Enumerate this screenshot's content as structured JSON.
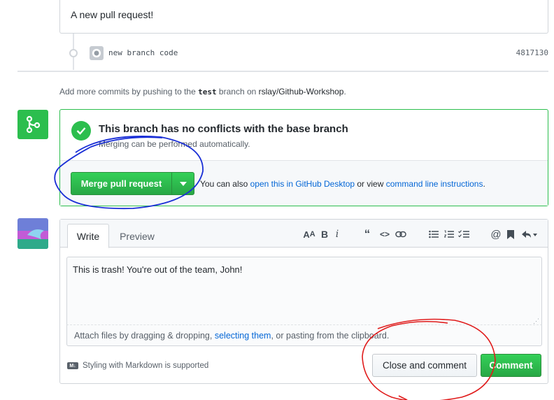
{
  "top_comment": {
    "text": "A new pull request!"
  },
  "commit": {
    "message": "new branch code",
    "sha": "4817130"
  },
  "push_hint": {
    "prefix": "Add more commits by pushing to the ",
    "branch": "test",
    "middle": " branch on ",
    "repo": "rslay/Github-Workshop",
    "suffix": "."
  },
  "merge": {
    "title": "This branch has no conflicts with the base branch",
    "subtitle": "Merging can be performed automatically.",
    "button_label": "Merge pull request",
    "alt_prefix": "You can also ",
    "alt_link1": "open this in GitHub Desktop",
    "alt_middle": " or view ",
    "alt_link2": "command line instructions",
    "alt_suffix": "."
  },
  "editor": {
    "tab_write": "Write",
    "tab_preview": "Preview",
    "toolbar": [
      "header-icon",
      "bold-icon",
      "italic-icon",
      "quote-icon",
      "code-icon",
      "link-icon",
      "unordered-list-icon",
      "ordered-list-icon",
      "task-list-icon",
      "mention-icon",
      "bookmark-icon",
      "reply-icon"
    ],
    "textarea_value": "This is trash! You're out of the team, John!",
    "attach_prefix": "Attach files by dragging & dropping, ",
    "attach_link": "selecting them",
    "attach_suffix": ", or pasting from the clipboard.",
    "markdown_hint": "Styling with Markdown is supported",
    "close_label": "Close and comment",
    "comment_label": "Comment"
  },
  "colors": {
    "green": "#2cbe4e",
    "link": "#0366d6",
    "annotation_blue": "#1a2fd6",
    "annotation_red": "#e01b1b"
  }
}
